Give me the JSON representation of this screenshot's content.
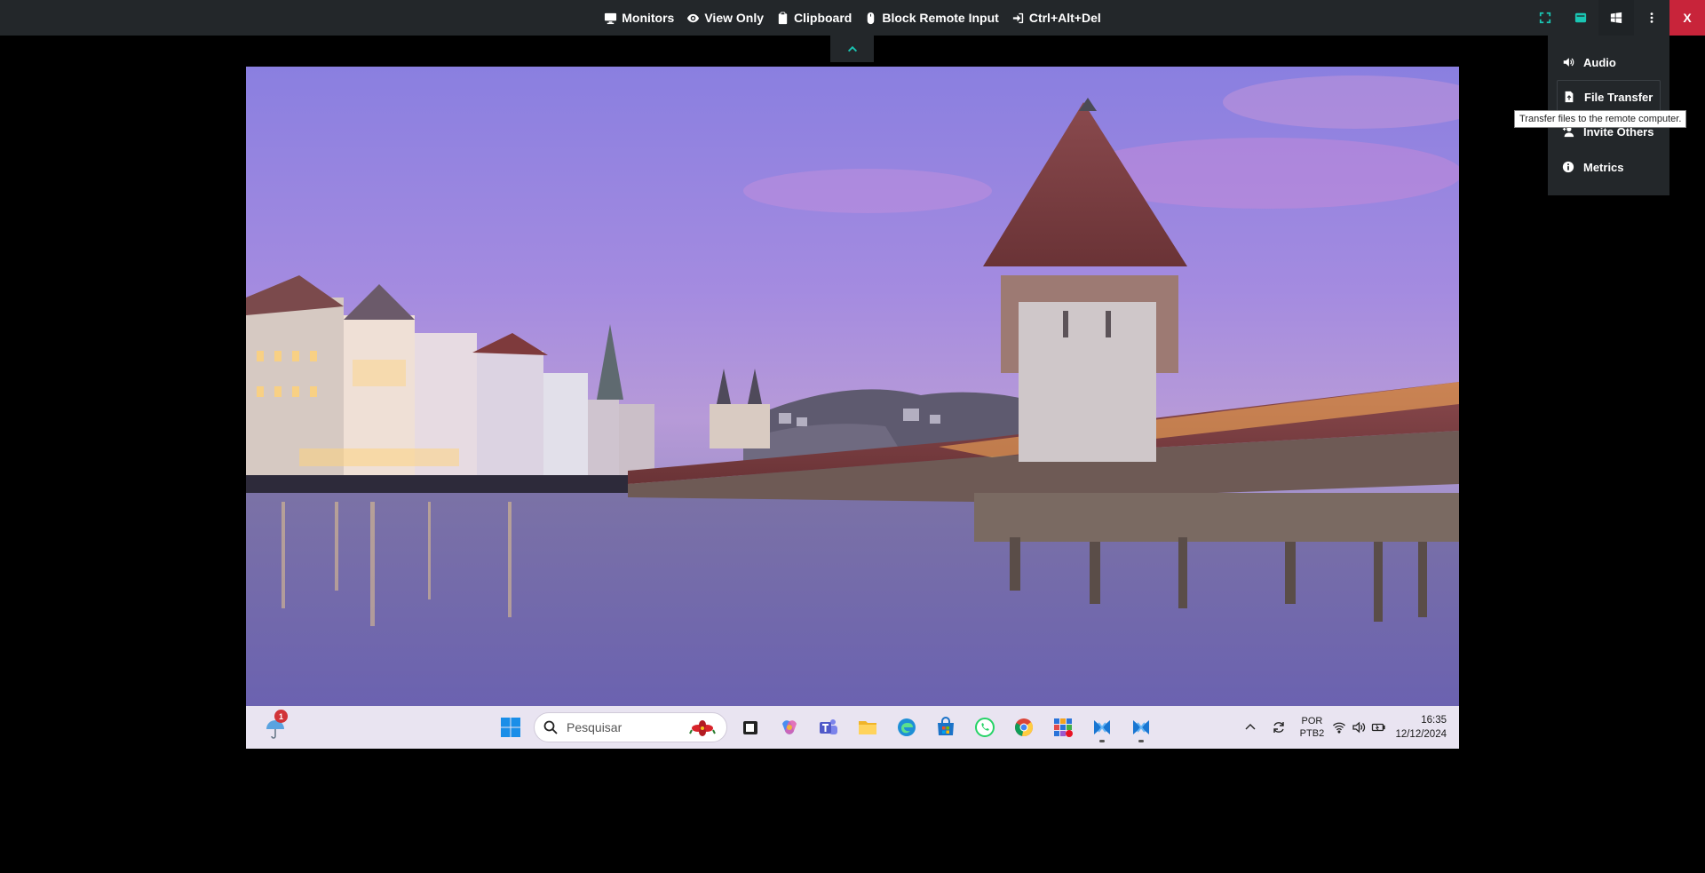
{
  "toolbar": {
    "items": [
      {
        "label": "Monitors",
        "icon": "monitor-icon"
      },
      {
        "label": "View Only",
        "icon": "eye-icon"
      },
      {
        "label": "Clipboard",
        "icon": "clipboard-icon"
      },
      {
        "label": "Block Remote Input",
        "icon": "mouse-icon"
      },
      {
        "label": "Ctrl+Alt+Del",
        "icon": "sign-in-icon"
      }
    ],
    "right_buttons": [
      "fit-screen-icon",
      "keyboard-icon",
      "windows-icon",
      "more-vertical-icon"
    ],
    "close_label": "X",
    "colors": {
      "background": "#23272a",
      "accent": "#1ac6b3",
      "close": "#c8243a"
    }
  },
  "menu": {
    "items": [
      {
        "label": "Audio",
        "icon": "volume-icon"
      },
      {
        "label": "File Transfer",
        "icon": "file-upload-icon"
      },
      {
        "label": "Invite Others",
        "icon": "user-plus-icon"
      },
      {
        "label": "Metrics",
        "icon": "info-icon"
      }
    ],
    "tooltip": "Transfer files to the remote computer."
  },
  "remote": {
    "taskbar": {
      "weather_badge": "1",
      "search_placeholder": "Pesquisar",
      "apps": [
        "windows-start-icon",
        "search",
        "task-view-icon",
        "copilot-icon",
        "teams-icon",
        "file-explorer-icon",
        "edge-icon",
        "store-icon",
        "whatsapp-icon",
        "chrome-icon",
        "app-grid-icon",
        "remote-app-icon",
        "remote-app-icon"
      ],
      "tray": {
        "lang_line1": "POR",
        "lang_line2": "PTB2",
        "time": "16:35",
        "date": "12/12/2024"
      }
    }
  }
}
